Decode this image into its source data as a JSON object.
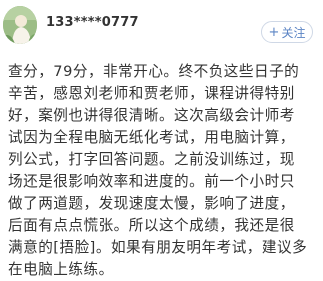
{
  "post": {
    "username": "133****0777",
    "follow": {
      "icon": "+",
      "label": "关注"
    },
    "content_lines": [
      "查分，79分，非常开心。终不负这些日子的",
      "辛苦，感恩刘老师和贾老师，课程讲得特别",
      "好，案例也讲得很清晰。这次高级会计师考",
      "试因为全程电脑无纸化考试，用电脑计算，",
      "列公式，打字回答问题。之前没训练过，现",
      "场还是很影响效率和进度的。前一个小时只",
      "做了两道题，发现速度太慢，影响了进度，",
      "后面有点点慌张。所以这个成绩，我还是很",
      "满意的[捂脸]。如果有朋友明年考试，建议多",
      "在电脑上练练。"
    ]
  }
}
